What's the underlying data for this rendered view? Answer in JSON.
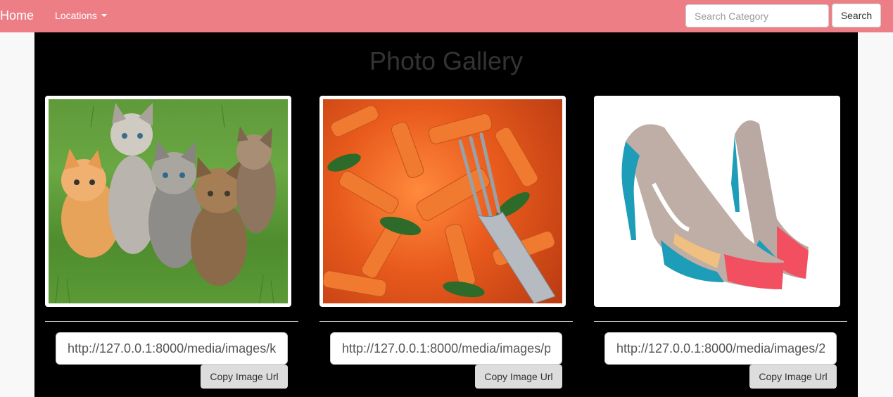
{
  "navbar": {
    "brand": "Home",
    "locations_label": "Locations",
    "search_placeholder": "Search Category",
    "search_button": "Search"
  },
  "gallery": {
    "title": "Photo Gallery",
    "items": [
      {
        "image": "kittens-photo",
        "url": "http://127.0.0.1:8000/media/images/k",
        "copy_label": "Copy Image Url"
      },
      {
        "image": "pasta-photo",
        "url": "http://127.0.0.1:8000/media/images/p",
        "copy_label": "Copy Image Url"
      },
      {
        "image": "shoes-photo",
        "url": "http://127.0.0.1:8000/media/images/2",
        "copy_label": "Copy Image Url"
      }
    ]
  },
  "colors": {
    "navbar_bg": "#ee7e86",
    "page_bg": "#000000",
    "title": "#333333"
  }
}
